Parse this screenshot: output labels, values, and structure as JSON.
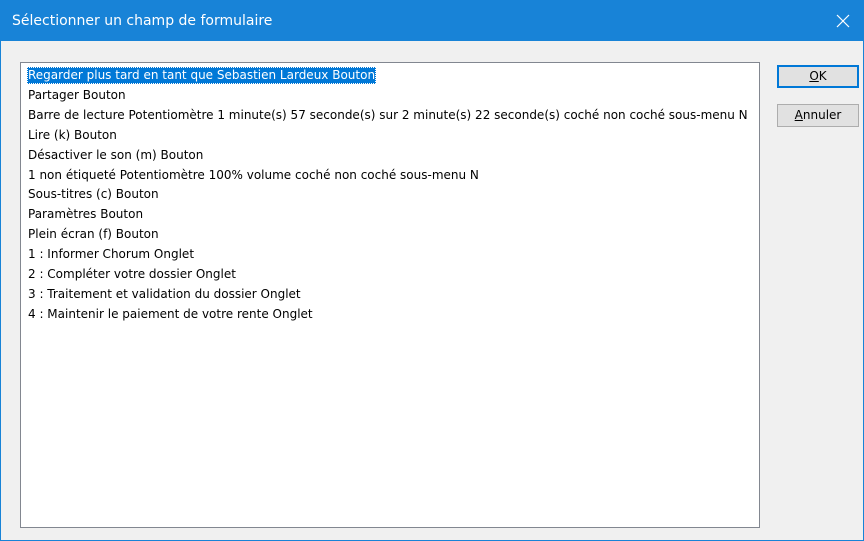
{
  "window": {
    "title": "Sélectionner un champ de formulaire",
    "close_glyph": "✕"
  },
  "list": {
    "selected_index": 0,
    "items": [
      "Regarder plus tard en tant que Sebastien Lardeux Bouton",
      "Partager Bouton",
      "Barre de lecture Potentiomètre 1 minute(s) 57 seconde(s) sur 2 minute(s) 22 seconde(s)  coché  non coché  sous-menu N",
      "Lire (k) Bouton",
      "Désactiver le son (m) Bouton",
      "1 non étiqueté Potentiomètre 100% volume  coché  non coché  sous-menu N",
      "Sous-titres (c) Bouton",
      "Paramètres Bouton",
      "Plein écran (f) Bouton",
      "1 : Informer Chorum Onglet",
      "2 : Compléter votre dossier Onglet",
      "3 : Traitement et validation du dossier Onglet",
      "4 : Maintenir le paiement de votre rente Onglet"
    ]
  },
  "buttons": {
    "ok": {
      "mnemonic": "O",
      "rest": "K"
    },
    "cancel": {
      "mnemonic": "A",
      "rest": "nnuler"
    }
  },
  "colors": {
    "titlebar": "#1883d7",
    "selection": "#0078d7",
    "window_bg": "#f0f0f0"
  }
}
